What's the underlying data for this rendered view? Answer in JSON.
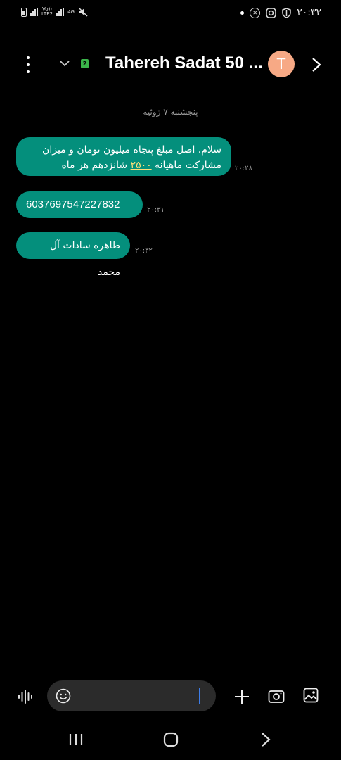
{
  "status_bar": {
    "network_label_top": "Vo))",
    "network_label_bottom": "LTE2",
    "network_4g": "4G",
    "time": "۲۰:۳۲",
    "x_icon_text": "✕"
  },
  "header": {
    "sim_number": "2",
    "contact_name": "Tahereh Sadat 50 ...",
    "avatar_letter": "T"
  },
  "conversation": {
    "date_label": "پنجشنبه ۷ ژوئیه",
    "messages": [
      {
        "text_line1": "سلام. اصل مبلغ پنجاه میلیون تومان و میزان",
        "text_line2_before": "مشارکت ماهیانه ",
        "text_line2_highlight": "۲۵۰۰",
        "text_line2_after": " شانزدهم هر ماه",
        "time": "۲۰:۲۸"
      },
      {
        "text": "6037697547227832",
        "time": "۲۰:۳۱"
      },
      {
        "text": "طاهره سادات آل محمد",
        "time": "۲۰:۳۲"
      }
    ]
  },
  "composer": {
    "input_value": "",
    "accent": "#3d7de8"
  },
  "colors": {
    "bubble": "#048f7c",
    "avatar": "#f7a985",
    "highlight": "#ffe07a",
    "sim_badge": "#3bb54a"
  }
}
